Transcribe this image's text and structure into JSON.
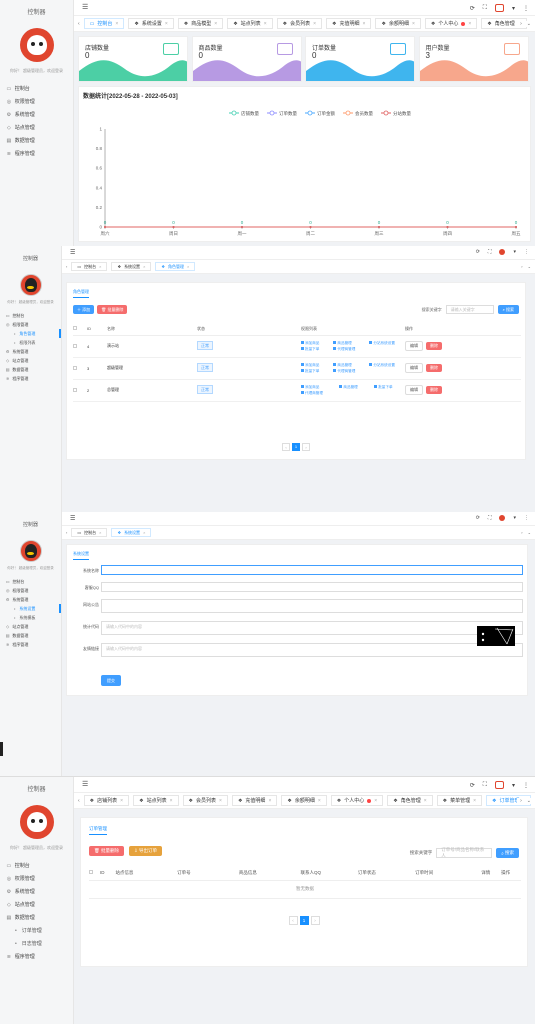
{
  "brand": "控制器",
  "greeting": "你好！ 超级管理员，欢迎登录",
  "p1": {
    "menu": [
      "控制台",
      "权限管理",
      "系统管理",
      "站点管理",
      "数据管理",
      "程序管理"
    ],
    "tabs": [
      "控制台",
      "系统设置",
      "商品模型",
      "站点列表",
      "会员列表",
      "充值明细",
      "余额明细",
      "个人中心",
      "角色管理"
    ],
    "stats": [
      {
        "label": "店铺数量",
        "value": "0",
        "color": "#4ccfa5"
      },
      {
        "label": "商品数量",
        "value": "0",
        "color": "#b79ae3"
      },
      {
        "label": "订单数量",
        "value": "0",
        "color": "#3fb5ee"
      },
      {
        "label": "用户数量",
        "value": "3",
        "color": "#f7a78c"
      }
    ],
    "chart_title": "数据统计[2022-05-28 - 2022-05-03]"
  },
  "chart_data": {
    "type": "line",
    "categories": [
      "周六",
      "周日",
      "周一",
      "周二",
      "周三",
      "周四",
      "周五"
    ],
    "series": [
      {
        "name": "店铺数量",
        "values": [
          0,
          0,
          0,
          0,
          0,
          0,
          0
        ],
        "color": "#45d0b3"
      },
      {
        "name": "订单数量",
        "values": [
          0,
          0,
          0,
          0,
          0,
          0,
          0
        ],
        "color": "#8c8cff"
      },
      {
        "name": "订单金额",
        "values": [
          0,
          0,
          0,
          0,
          0,
          0,
          0
        ],
        "color": "#4aa8ff"
      },
      {
        "name": "会员数量",
        "values": [
          0,
          0,
          0,
          0,
          0,
          0,
          0
        ],
        "color": "#ff9a6a"
      },
      {
        "name": "分站数量",
        "values": [
          0,
          0,
          0,
          0,
          0,
          0,
          0
        ],
        "color": "#e06060"
      }
    ],
    "yticks": [
      "1",
      "0.8",
      "0.6",
      "0.4",
      "0.2",
      "0"
    ],
    "data_labels": [
      "0",
      "0",
      "0",
      "0",
      "0",
      "0",
      "0"
    ],
    "ylim": [
      0,
      1
    ]
  },
  "p2": {
    "menu": [
      "控制台",
      "权限管理",
      "角色管理",
      "权限列表",
      "系统管理",
      "站点管理",
      "数据管理",
      "程序管理"
    ],
    "tabs": [
      "控制台",
      "系统设置",
      "角色管理"
    ],
    "crumb": "角色管理",
    "add": "添加",
    "del": "批量删除",
    "search_label": "搜索关键字",
    "search_ph": "请输入关键字",
    "search_btn": "搜索",
    "cols": [
      "ID",
      "名称",
      "状态",
      "权限列表",
      "操作"
    ],
    "rows": [
      {
        "id": "4",
        "name": "演示站",
        "status": "正常",
        "perms": [
          "添加商品",
          "商品管理",
          "分站系统设置",
          "批量下单",
          "代理商管理"
        ],
        "edit": "编辑",
        "delete": "删除"
      },
      {
        "id": "3",
        "name": "超级管理",
        "status": "正常",
        "perms": [
          "添加商品",
          "商品管理",
          "分站系统设置",
          "批量下单",
          "代理商管理"
        ],
        "edit": "编辑",
        "delete": "删除"
      },
      {
        "id": "2",
        "name": "总管理",
        "status": "正常",
        "perms": [
          "添加商品",
          "商品管理",
          "批量下单",
          "代理商管理"
        ],
        "edit": "编辑",
        "delete": "删除"
      }
    ],
    "page": "1"
  },
  "p3": {
    "menu": [
      "控制台",
      "权限管理",
      "系统管理",
      "系统设置",
      "系统模板",
      "站点管理",
      "数据管理",
      "程序管理"
    ],
    "tabs": [
      "控制台",
      "系统设置"
    ],
    "crumb": "系统设置",
    "fields": [
      {
        "label": "系统名称",
        "ph": ""
      },
      {
        "label": "客服QQ",
        "ph": ""
      },
      {
        "label": "网站公告",
        "ph": ""
      },
      {
        "label": "统计代码",
        "ph": "请输入代码中的内容"
      },
      {
        "label": "友情链接",
        "ph": "请输入代码中的内容"
      }
    ],
    "submit": "提交"
  },
  "p4": {
    "menu": [
      "控制台",
      "权限管理",
      "系统管理",
      "站点管理",
      "数据管理",
      "订单管理",
      "日志管理",
      "程序管理"
    ],
    "tabs": [
      "店铺列表",
      "站点列表",
      "会员列表",
      "充值明细",
      "余额明细",
      "个人中心",
      "角色管理",
      "菜单管理",
      "订单管理"
    ],
    "crumb": "订单管理",
    "del": "批量删除",
    "export": "导出订单",
    "search_label": "搜索关键字",
    "search_ph": "订单号/商品名称/联系人",
    "search_btn": "搜索",
    "cols": [
      "ID",
      "站点信息",
      "订单号",
      "商品信息",
      "联系人QQ",
      "订单状态",
      "订单时间",
      "详情",
      "操作"
    ],
    "empty": "暂无数据",
    "page": "1"
  }
}
